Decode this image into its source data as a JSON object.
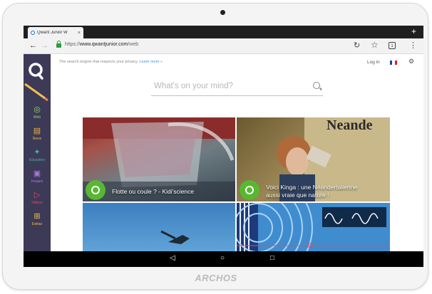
{
  "device": {
    "brand": "ARCHOS"
  },
  "browser": {
    "tab_title": "Qwant Junior W",
    "tab_close": "×",
    "new_tab": "+",
    "url_scheme": "https://",
    "url_host": "www.qwantjunior.com",
    "url_path": "/web",
    "tab_count": "1"
  },
  "page": {
    "tagline": "The search engine that respects your privacy.",
    "learn_more": "Learn more »",
    "login": "Log in",
    "search_placeholder": "What's on your mind?"
  },
  "sidebar": {
    "items": [
      {
        "label": "Web",
        "icon": "web-icon",
        "glyph": "◎"
      },
      {
        "label": "News",
        "icon": "news-icon",
        "glyph": "▤"
      },
      {
        "label": "Education",
        "icon": "education-icon",
        "glyph": "✦"
      },
      {
        "label": "Images",
        "icon": "images-icon",
        "glyph": "▣"
      },
      {
        "label": "Videos",
        "icon": "videos-icon",
        "glyph": "▷"
      },
      {
        "label": "Extras",
        "icon": "extras-icon",
        "glyph": "⊞"
      }
    ]
  },
  "cards": [
    {
      "caption": "Flotte ou coule ? - Kidi'science"
    },
    {
      "caption_line1": "Voici Kinga : une Néandertalienne",
      "caption_line2": "aussi vraie que nature !",
      "overlay_text": "Neande"
    },
    {
      "caption": ""
    },
    {
      "caption": ""
    }
  ],
  "colors": {
    "sidebar_bg": "#3d3a57",
    "accent_green": "#58b832",
    "active_web": "#58b832"
  }
}
